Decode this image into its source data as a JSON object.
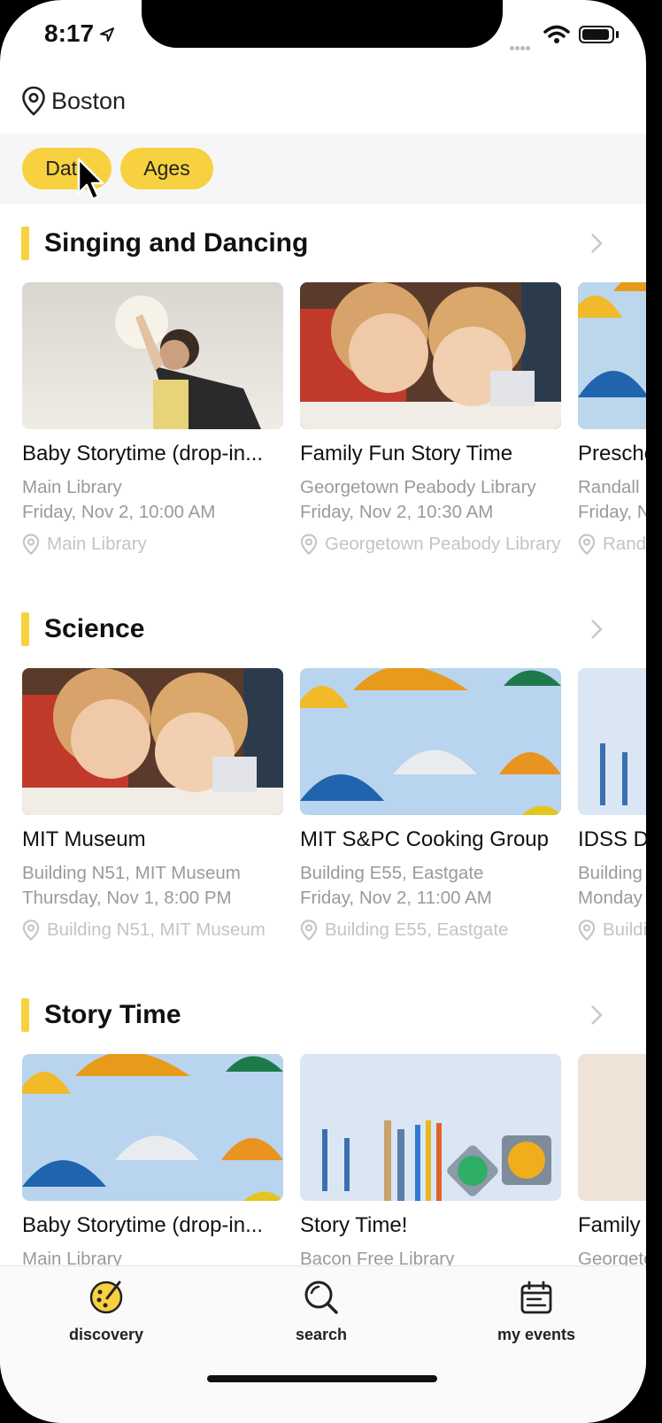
{
  "status_bar": {
    "time": "8:17"
  },
  "location": {
    "label": "Boston"
  },
  "filters": [
    {
      "label": "Date"
    },
    {
      "label": "Ages"
    }
  ],
  "sections": [
    {
      "title": "Singing and Dancing",
      "cards": [
        {
          "title": "Baby Storytime (drop-in...",
          "place": "Main Library",
          "datetime": "Friday, Nov 2, 10:00 AM",
          "venue": "Main Library",
          "image": "child-superhero-cape"
        },
        {
          "title": "Family Fun Story Time",
          "place": "Georgetown Peabody Library",
          "datetime": "Friday, Nov 2, 10:30 AM",
          "venue": "Georgetown Peabody Library",
          "image": "kids-drawing"
        },
        {
          "title": "Preschool",
          "place": "Randall",
          "datetime": "Friday, Nov",
          "venue": "Randall",
          "image": "umbrellas"
        }
      ]
    },
    {
      "title": "Science",
      "cards": [
        {
          "title": "MIT Museum",
          "place": "Building N51, MIT Museum",
          "datetime": "Thursday, Nov 1, 8:00 PM",
          "venue": "Building N51, MIT Museum",
          "image": "kids-drawing"
        },
        {
          "title": "MIT S&PC Cooking Group",
          "place": "Building E55, Eastgate",
          "datetime": "Friday, Nov 2, 11:00 AM",
          "venue": "Building E55, Eastgate",
          "image": "umbrellas"
        },
        {
          "title": "IDSS D",
          "place": "Building",
          "datetime": "Monday",
          "venue": "Building",
          "image": "art-supplies"
        }
      ]
    },
    {
      "title": "Story Time",
      "cards": [
        {
          "title": "Baby Storytime (drop-in...",
          "place": "Main Library",
          "datetime": "",
          "venue": "",
          "image": "umbrellas"
        },
        {
          "title": "Story Time!",
          "place": "Bacon Free Library",
          "datetime": "",
          "venue": "",
          "image": "art-supplies"
        },
        {
          "title": "Family",
          "place": "Georgetown",
          "datetime": "",
          "venue": "",
          "image": "sky"
        }
      ]
    }
  ],
  "tabs": [
    {
      "label": "discovery",
      "icon": "palette-icon"
    },
    {
      "label": "search",
      "icon": "search-icon"
    },
    {
      "label": "my events",
      "icon": "calendar-icon"
    }
  ],
  "colors": {
    "accent": "#f7d13f",
    "muted_text": "#9a9a9a",
    "venue_text": "#c4c4c4"
  }
}
